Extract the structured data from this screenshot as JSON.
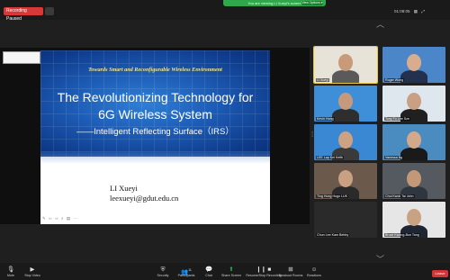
{
  "topbar": {
    "recording_label": "Recording Paused",
    "share_banner": "You are viewing LI Xueyi's screen",
    "share_options": "View Options ▾",
    "meeting_timer": "01:08:05"
  },
  "slide": {
    "subtitle": "Towards Smart and Reconfigurable Wireless Environment",
    "title_line1": "The Revolutionizing Technology for",
    "title_line2": "6G Wireless System",
    "title_line3": "——Intelligent Reflecting Surface（IRS）",
    "presenter_name": "LI Xueyi",
    "presenter_email": "leexueyi@gdut.edu.cn"
  },
  "participants": [
    {
      "name": "LI Xueyi",
      "bg": "#e8e3d8",
      "skin": "#c99a7a",
      "shirt": "#5a5a5a",
      "active": true
    },
    {
      "name": "Roger Wong",
      "bg": "#4a86c8",
      "skin": "#d8ad8e",
      "shirt": "#23314f"
    },
    {
      "name": "Kevin Hung",
      "bg": "#3f8fd8",
      "skin": "#c59a7c",
      "shirt": "#2e2e2e"
    },
    {
      "name": "Tony Fu Lee Sze",
      "bg": "#dfe7ee",
      "skin": "#caa083",
      "shirt": "#202020"
    },
    {
      "name": "LEE Lap Kei Keith",
      "bg": "#3a88d4",
      "skin": "#cca283",
      "shirt": "#3a3a3a"
    },
    {
      "name": "Vanessa Ng",
      "bg": "#4a8cc0",
      "skin": "#d4a98a",
      "shirt": "#1a1a1a"
    },
    {
      "name": "Ting Hung Hugo LUK",
      "bg": "#6b5a4c",
      "skin": "#caa083",
      "shirt": "#2a2a2a"
    },
    {
      "name": "Chui Kwok Tai John",
      "bg": "#555a60",
      "skin": "#c29878",
      "shirt": "#2f3640"
    },
    {
      "name": "Chun Lee Kam Bebby",
      "bg": "#2a2a2a",
      "skin": "",
      "shirt": ""
    },
    {
      "name": "Bruce Kwong-Bun Tang",
      "bg": "#e6e6e6",
      "skin": "#c9a183",
      "shirt": "#1f2533"
    }
  ],
  "toolbar": {
    "unmute": "Mute",
    "video": "Stop Video",
    "security": "Security",
    "participants": "Participants",
    "participants_count": "11",
    "chat": "Chat",
    "share": "Share Screen",
    "record": "Resume/Stop Recording",
    "breakout": "Breakout Rooms",
    "reactions": "Reactions",
    "leave": "Leave"
  },
  "colors": {
    "share_green": "#2ea84a",
    "leave_red": "#d63434",
    "record_red": "#d93838"
  }
}
